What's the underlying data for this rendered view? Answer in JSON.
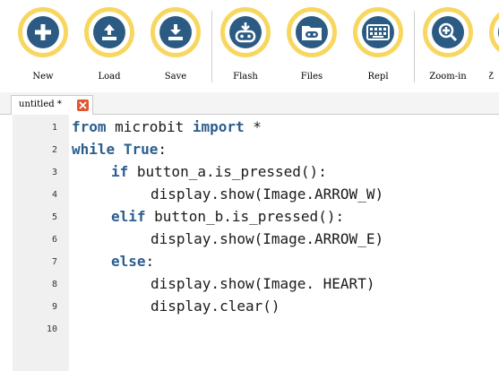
{
  "toolbar": {
    "buttons": [
      {
        "label": "New",
        "icon": "plus-icon"
      },
      {
        "label": "Load",
        "icon": "upload-icon"
      },
      {
        "label": "Save",
        "icon": "download-icon"
      },
      {
        "label": "Flash",
        "icon": "microbit-flash-icon"
      },
      {
        "label": "Files",
        "icon": "folder-microbit-icon"
      },
      {
        "label": "Repl",
        "icon": "keyboard-icon"
      },
      {
        "label": "Zoom-in",
        "icon": "zoom-in-icon"
      },
      {
        "label": "Z",
        "icon": "zoom-out-icon"
      }
    ],
    "accent_color": "#f8d760",
    "icon_color": "#2b5b83"
  },
  "tabs": [
    {
      "label": "untitled *",
      "close_icon": "close-icon",
      "close_color": "#e2562f"
    }
  ],
  "editor": {
    "line_numbers": [
      "1",
      "2",
      "3",
      "4",
      "5",
      "6",
      "7",
      "8",
      "9",
      "10"
    ],
    "lines": [
      {
        "kw1": "from",
        "t1": " microbit ",
        "kw2": "import",
        "t2": " *"
      },
      {
        "kw1": "while",
        "t1": " ",
        "kw2": "True",
        "t2": ":"
      },
      {
        "kw1": "if",
        "t1": " button_a.is_pressed():"
      },
      {
        "t1": "display.show(Image.ARROW_W)"
      },
      {
        "kw1": "elif",
        "t1": " button_b.is_pressed():"
      },
      {
        "t1": "display.show(Image.ARROW_E)"
      },
      {
        "kw1": "else",
        "t1": ":"
      },
      {
        "t1": "display.show(Image. HEART)"
      },
      {
        "t1": "display.clear()"
      },
      {
        "t1": ""
      }
    ],
    "keyword_color": "#2b5e8e"
  }
}
